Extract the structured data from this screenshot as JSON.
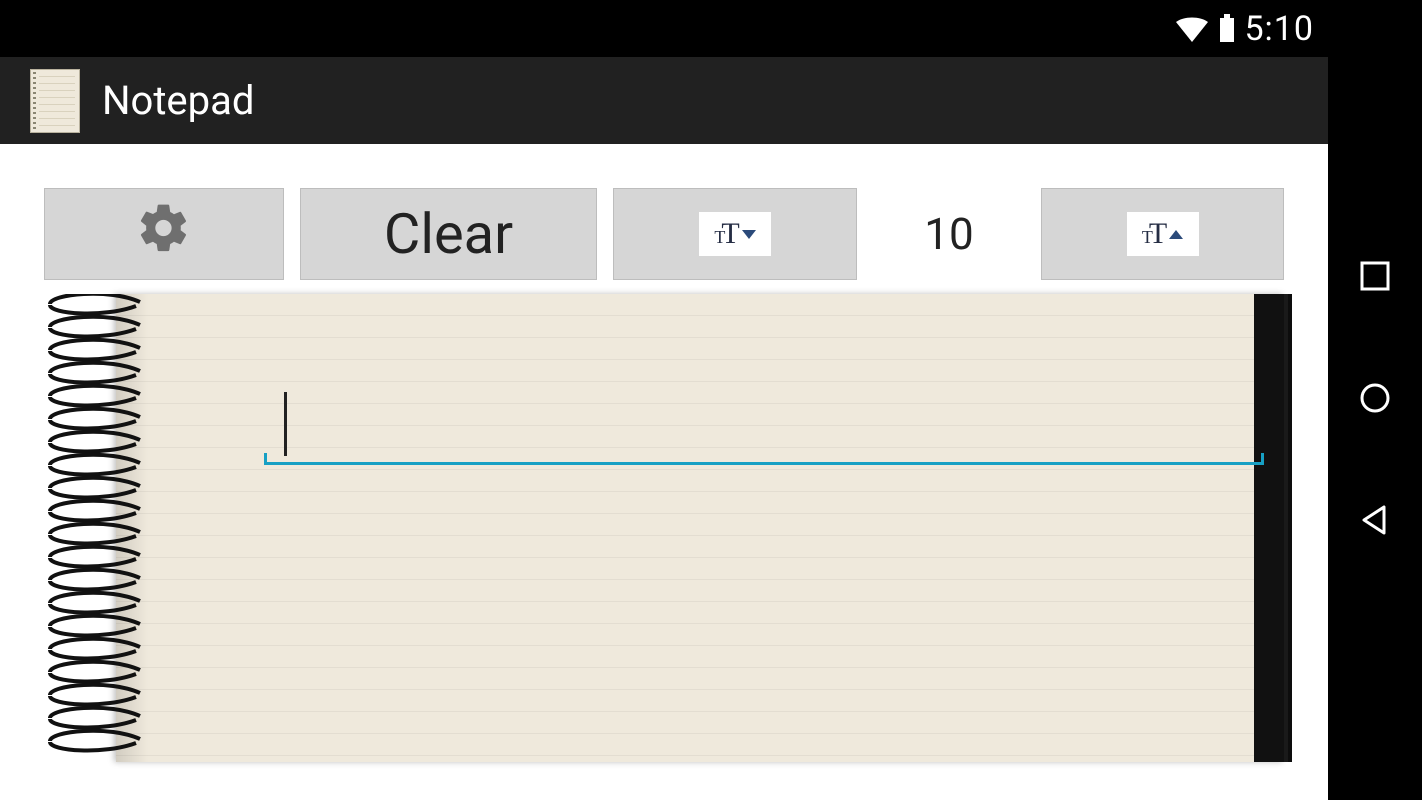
{
  "status": {
    "time": "5:10"
  },
  "app": {
    "title": "Notepad"
  },
  "toolbar": {
    "settings_icon": "gear",
    "clear_label": "Clear",
    "font_dec_icon": "tT-down",
    "font_size_value": "10",
    "font_inc_icon": "tT-up"
  },
  "note": {
    "text": ""
  },
  "nav": {
    "recent": "square",
    "home": "circle",
    "back": "triangle"
  }
}
